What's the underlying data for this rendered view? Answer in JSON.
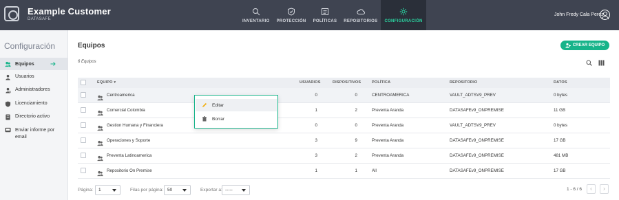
{
  "brand": {
    "title": "Example Customer",
    "subtitle": "DATASAFE"
  },
  "nav": [
    {
      "label": "INVENTARIO",
      "icon": "search-icon"
    },
    {
      "label": "PROTECCIÓN",
      "icon": "shield-icon"
    },
    {
      "label": "POLÍTICAS",
      "icon": "policy-icon"
    },
    {
      "label": "REPOSITORIOS",
      "icon": "cloud-icon"
    },
    {
      "label": "CONFIGURACIÓN",
      "icon": "gear-icon",
      "active": true
    }
  ],
  "user": {
    "name": "John Fredy Cala Perez"
  },
  "sidebar": {
    "title": "Configuración",
    "items": [
      {
        "label": "Equipos",
        "icon": "team-icon",
        "active": true
      },
      {
        "label": "Usuarios",
        "icon": "user-icon"
      },
      {
        "label": "Administradores",
        "icon": "admin-icon"
      },
      {
        "label": "Licenciamiento",
        "icon": "license-icon"
      },
      {
        "label": "Directorio activo",
        "icon": "directory-icon"
      },
      {
        "label": "Enviar informe por email",
        "icon": "report-icon"
      }
    ]
  },
  "main": {
    "title": "Equipos",
    "count": "6 Equipos",
    "create_label": "CREAR EQUIPO"
  },
  "table": {
    "headers": {
      "equipo": "EQUIPO",
      "usuarios": "USUARIOS",
      "dispositivos": "DISPOSITIVOS",
      "politica": "POLÍTICA",
      "repositorio": "REPOSITORIO",
      "datos": "DATOS"
    },
    "rows": [
      {
        "equipo": "Centroamerica",
        "usuarios": "0",
        "dispositivos": "0",
        "politica": "CENTROAMERICA",
        "repositorio": "VAULT_ADTSV9_PREV",
        "datos": "0 bytes"
      },
      {
        "equipo": "Comercial Colombia",
        "usuarios": "1",
        "dispositivos": "2",
        "politica": "Preventa Aranda",
        "repositorio": "DATASAFEv9_ONPREMISE",
        "datos": "11 GB"
      },
      {
        "equipo": "Gestion Humana y Financiera",
        "usuarios": "0",
        "dispositivos": "0",
        "politica": "Preventa Aranda",
        "repositorio": "VAULT_ADTSV9_PREV",
        "datos": "0 bytes"
      },
      {
        "equipo": "Operaciones y Soporte",
        "usuarios": "3",
        "dispositivos": "9",
        "politica": "Preventa Aranda",
        "repositorio": "DATASAFEv9_ONPREMISE",
        "datos": "17 GB"
      },
      {
        "equipo": "Preventa Latinoamerica",
        "usuarios": "3",
        "dispositivos": "2",
        "politica": "Preventa Aranda",
        "repositorio": "DATASAFEv9_ONPREMISE",
        "datos": "481 MB"
      },
      {
        "equipo": "Repositorio On Premise",
        "usuarios": "1",
        "dispositivos": "1",
        "politica": "All",
        "repositorio": "DATASAFEv9_ONPREMISE",
        "datos": "17 GB"
      }
    ]
  },
  "context_menu": {
    "edit": "Editar",
    "delete": "Borrar"
  },
  "footer": {
    "page_label": "Página:",
    "page_value": "1",
    "per_page_label": "Filas por página:",
    "per_page_value": "50",
    "export_label": "Exportar a:",
    "export_value": "-----",
    "range": "1 - 6 / 6"
  },
  "colors": {
    "topbar": "#3f4451",
    "accent": "#17b48a",
    "active_nav": "#2bd6a2"
  }
}
